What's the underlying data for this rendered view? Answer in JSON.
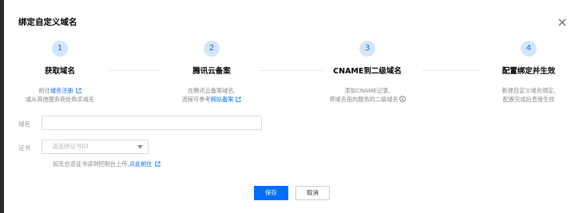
{
  "dialog": {
    "title": "绑定自定义域名"
  },
  "steps": [
    {
      "number": "1",
      "title": "获取域名",
      "desc_line1_prefix": "前往",
      "desc_line1_link": "域名注册",
      "desc_line2": "或从其他服务商处购买域名"
    },
    {
      "number": "2",
      "title": "腾讯云备案",
      "desc_line1": "在腾讯云备案域名,",
      "desc_line2_prefix": "流程可参考",
      "desc_line2_link": "网站备案"
    },
    {
      "number": "3",
      "title": "CNAME到二级域名",
      "desc_line1": "添加CNAME记录,",
      "desc_line2": "将域名指向服务的二级域名"
    },
    {
      "number": "4",
      "title": "配置绑定并生效",
      "desc_line1": "新建自定义域名绑定,",
      "desc_line2": "配置完成后直接生效"
    }
  ],
  "form": {
    "domain_label": "域名",
    "domain_value": "",
    "cert_label": "证书",
    "cert_placeholder": "请选择证书ID",
    "hint_prefix": "如无合适证书请到控制台上传,",
    "hint_link": "点此前往"
  },
  "buttons": {
    "save": "保存",
    "cancel": "取消"
  },
  "colors": {
    "accent": "#006eff",
    "step_circle_bg": "#d5e6fb",
    "backdrop": "#2b2b2b"
  }
}
